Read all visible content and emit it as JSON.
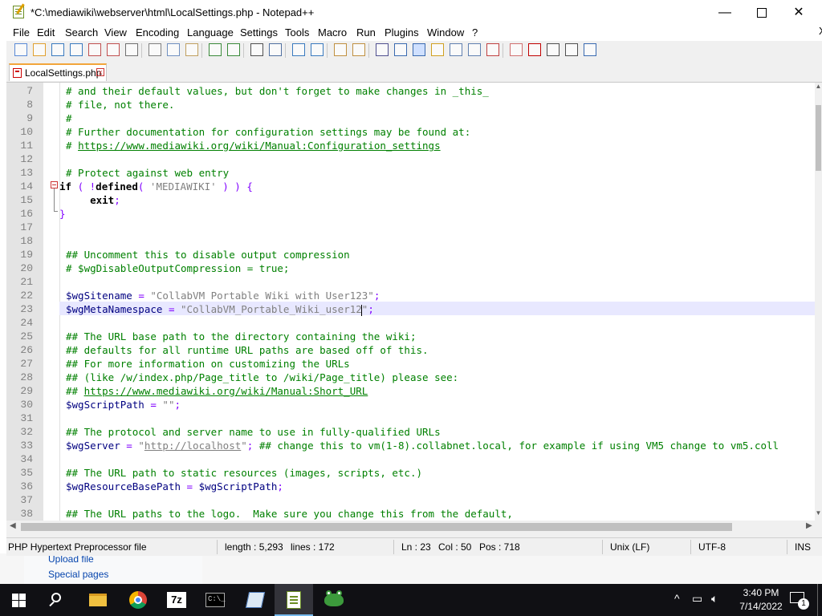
{
  "window": {
    "title": "*C:\\mediawiki\\webserver\\html\\LocalSettings.php - Notepad++",
    "min_glyph": "—",
    "close_glyph": "✕"
  },
  "menu": [
    "File",
    "Edit",
    "Search",
    "View",
    "Encoding",
    "Language",
    "Settings",
    "Tools",
    "Macro",
    "Run",
    "Plugins",
    "Window",
    "?"
  ],
  "menu_extra": "X",
  "toolbar_icons": [
    "new-file-icon",
    "open-file-icon",
    "save-icon",
    "save-all-icon",
    "close-icon",
    "close-all-icon",
    "print-icon",
    "cut-icon",
    "copy-icon",
    "paste-icon",
    "undo-icon",
    "redo-icon",
    "find-icon",
    "replace-icon",
    "zoom-in-icon",
    "zoom-out-icon",
    "sync-vertical-icon",
    "sync-horizontal-icon",
    "word-wrap-icon",
    "show-all-chars-icon",
    "indent-guide-icon",
    "language-icon",
    "doc-map-icon",
    "function-list-icon",
    "folder-workspace-icon",
    "monitor-icon",
    "record-macro-icon",
    "stop-macro-icon",
    "play-macro-icon",
    "run-macro-multiple-icon",
    "save-macro-icon"
  ],
  "tab": {
    "label": "LocalSettings.php",
    "close_glyph": "x"
  },
  "lines": [
    {
      "n": "7",
      "segs": [
        {
          "t": "# and their default values, but don't forget to make changes in _this_",
          "c": "c-comment"
        }
      ]
    },
    {
      "n": "8",
      "segs": [
        {
          "t": "# file, not there.",
          "c": "c-comment"
        }
      ]
    },
    {
      "n": "9",
      "segs": [
        {
          "t": "#",
          "c": "c-comment"
        }
      ]
    },
    {
      "n": "10",
      "segs": [
        {
          "t": "# Further documentation for configuration settings may be found at:",
          "c": "c-comment"
        }
      ]
    },
    {
      "n": "11",
      "segs": [
        {
          "t": "# ",
          "c": "c-comment"
        },
        {
          "t": "https://www.mediawiki.org/wiki/Manual:Configuration_settings",
          "c": "c-link"
        }
      ]
    },
    {
      "n": "12",
      "segs": []
    },
    {
      "n": "13",
      "segs": [
        {
          "t": "# Protect against web entry",
          "c": "c-comment"
        }
      ]
    },
    {
      "n": "14",
      "segs": [
        {
          "t": "if",
          "c": "c-kw"
        },
        {
          "t": " ( ",
          "c": "c-op"
        },
        {
          "t": "!",
          "c": "c-op"
        },
        {
          "t": "defined",
          "c": "c-kw"
        },
        {
          "t": "( ",
          "c": "c-op"
        },
        {
          "t": "'MEDIAWIKI'",
          "c": "c-str"
        },
        {
          "t": " ) ) {",
          "c": "c-op"
        }
      ],
      "nopad": true
    },
    {
      "n": "15",
      "segs": [
        {
          "t": "    "
        },
        {
          "t": "exit",
          "c": "c-kw"
        },
        {
          "t": ";",
          "c": "c-op"
        }
      ]
    },
    {
      "n": "16",
      "segs": [
        {
          "t": "}",
          "c": "c-op"
        }
      ],
      "nopad": true
    },
    {
      "n": "17",
      "segs": []
    },
    {
      "n": "18",
      "segs": []
    },
    {
      "n": "19",
      "segs": [
        {
          "t": "## Uncomment this to disable output compression",
          "c": "c-comment"
        }
      ]
    },
    {
      "n": "20",
      "segs": [
        {
          "t": "# $wgDisableOutputCompression = true;",
          "c": "c-comment"
        }
      ]
    },
    {
      "n": "21",
      "segs": []
    },
    {
      "n": "22",
      "segs": [
        {
          "t": "$wgSitename",
          "c": "c-var"
        },
        {
          "t": " = ",
          "c": "c-op"
        },
        {
          "t": "\"CollabVM Portable Wiki with User123\"",
          "c": "c-str"
        },
        {
          "t": ";",
          "c": "c-op"
        }
      ]
    },
    {
      "n": "23",
      "segs": [
        {
          "t": "$wgMetaNamespace",
          "c": "c-var"
        },
        {
          "t": " = ",
          "c": "c-op"
        },
        {
          "t": "\"CollabVM_Portable_Wiki_user12",
          "c": "c-str"
        },
        {
          "caret": true
        },
        {
          "t": "\"",
          "c": "c-str"
        },
        {
          "t": ";",
          "c": "c-op"
        }
      ]
    },
    {
      "n": "24",
      "segs": []
    },
    {
      "n": "25",
      "segs": [
        {
          "t": "## The URL base path to the directory containing the wiki;",
          "c": "c-comment"
        }
      ]
    },
    {
      "n": "26",
      "segs": [
        {
          "t": "## defaults for all runtime URL paths are based off of this.",
          "c": "c-comment"
        }
      ]
    },
    {
      "n": "27",
      "segs": [
        {
          "t": "## For more information on customizing the URLs",
          "c": "c-comment"
        }
      ]
    },
    {
      "n": "28",
      "segs": [
        {
          "t": "## (like /w/index.php/Page_title to /wiki/Page_title) please see:",
          "c": "c-comment"
        }
      ]
    },
    {
      "n": "29",
      "segs": [
        {
          "t": "## ",
          "c": "c-comment"
        },
        {
          "t": "https://www.mediawiki.org/wiki/Manual:Short_URL",
          "c": "c-link"
        }
      ]
    },
    {
      "n": "30",
      "segs": [
        {
          "t": "$wgScriptPath",
          "c": "c-var"
        },
        {
          "t": " = ",
          "c": "c-op"
        },
        {
          "t": "\"\"",
          "c": "c-str"
        },
        {
          "t": ";",
          "c": "c-op"
        }
      ]
    },
    {
      "n": "31",
      "segs": []
    },
    {
      "n": "32",
      "segs": [
        {
          "t": "## The protocol and server name to use in fully-qualified URLs",
          "c": "c-comment"
        }
      ]
    },
    {
      "n": "33",
      "segs": [
        {
          "t": "$wgServer",
          "c": "c-var"
        },
        {
          "t": " = ",
          "c": "c-op"
        },
        {
          "t": "\"",
          "c": "c-str"
        },
        {
          "t": "http://localhost",
          "c": "c-str",
          "u": true
        },
        {
          "t": "\"",
          "c": "c-str"
        },
        {
          "t": "; ",
          "c": "c-op"
        },
        {
          "t": "## change this to vm(1-8).collabnet.local, for example if using VM5 change to vm5.coll",
          "c": "c-comment"
        }
      ]
    },
    {
      "n": "34",
      "segs": []
    },
    {
      "n": "35",
      "segs": [
        {
          "t": "## The URL path to static resources (images, scripts, etc.)",
          "c": "c-comment"
        }
      ]
    },
    {
      "n": "36",
      "segs": [
        {
          "t": "$wgResourceBasePath",
          "c": "c-var"
        },
        {
          "t": " = ",
          "c": "c-op"
        },
        {
          "t": "$wgScriptPath",
          "c": "c-var"
        },
        {
          "t": ";",
          "c": "c-op"
        }
      ]
    },
    {
      "n": "37",
      "segs": []
    },
    {
      "n": "38",
      "segs": [
        {
          "t": "## The URL paths to the logo.  Make sure you change this from the default,",
          "c": "c-comment"
        }
      ]
    }
  ],
  "status": {
    "filetype": "PHP Hypertext Preprocessor file",
    "length": "length : 5,293",
    "lines": "lines : 172",
    "ln": "Ln : 23",
    "col": "Col : 50",
    "pos": "Pos : 718",
    "eol": "Unix (LF)",
    "encoding": "UTF-8",
    "mode": "INS"
  },
  "background_page": {
    "link1": "Upload file",
    "link2": "Special pages"
  },
  "taskbar": {
    "apps": [
      "start",
      "search",
      "file-explorer",
      "chrome",
      "7zip",
      "command-prompt",
      "notepad",
      "notepad-plus-plus",
      "frog-app"
    ],
    "seven_zip_label": "7z",
    "cmd_label": "C:\\_",
    "tray_chevron": "^",
    "time": "3:40 PM",
    "date": "7/14/2022",
    "notification_count": "1"
  },
  "colors": {
    "comment": "#008000",
    "variable": "#000080",
    "string": "#808080",
    "operator": "#8000ff",
    "current_line": "#e8e8ff",
    "tab_accent": "#f2a53b"
  }
}
